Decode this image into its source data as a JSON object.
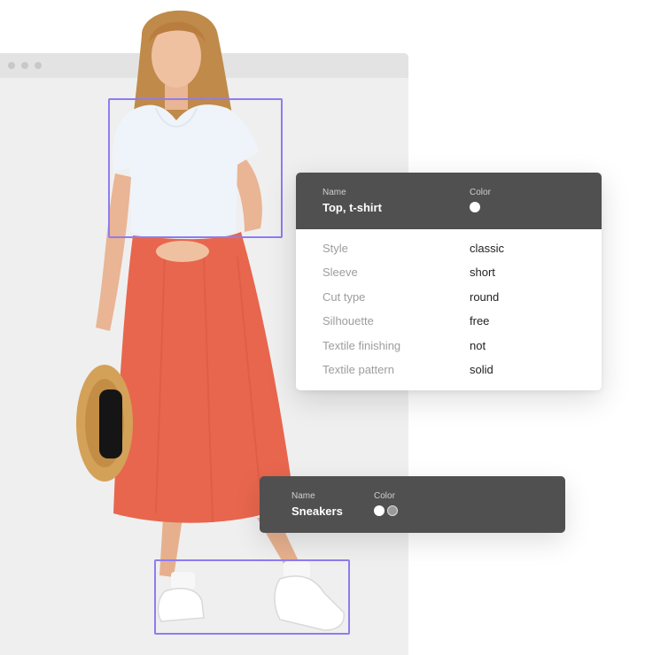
{
  "top_card": {
    "name_label": "Name",
    "name_value": "Top, t-shirt",
    "color_label": "Color",
    "colors": [
      "#ffffff"
    ],
    "attributes": [
      {
        "name": "Style",
        "value": "classic"
      },
      {
        "name": "Sleeve",
        "value": "short"
      },
      {
        "name": "Cut type",
        "value": "round"
      },
      {
        "name": "Silhouette",
        "value": "free"
      },
      {
        "name": "Textile finishing",
        "value": "not"
      },
      {
        "name": "Textile pattern",
        "value": "solid"
      }
    ]
  },
  "shoe_card": {
    "name_label": "Name",
    "name_value": "Sneakers",
    "color_label": "Color",
    "colors": [
      "#ffffff",
      "#9a9a9a"
    ]
  },
  "theme": {
    "accent": "#8e7cf0",
    "card_header": "#505050",
    "skirt": "#e8664d",
    "browser_bg": "#efefef"
  }
}
